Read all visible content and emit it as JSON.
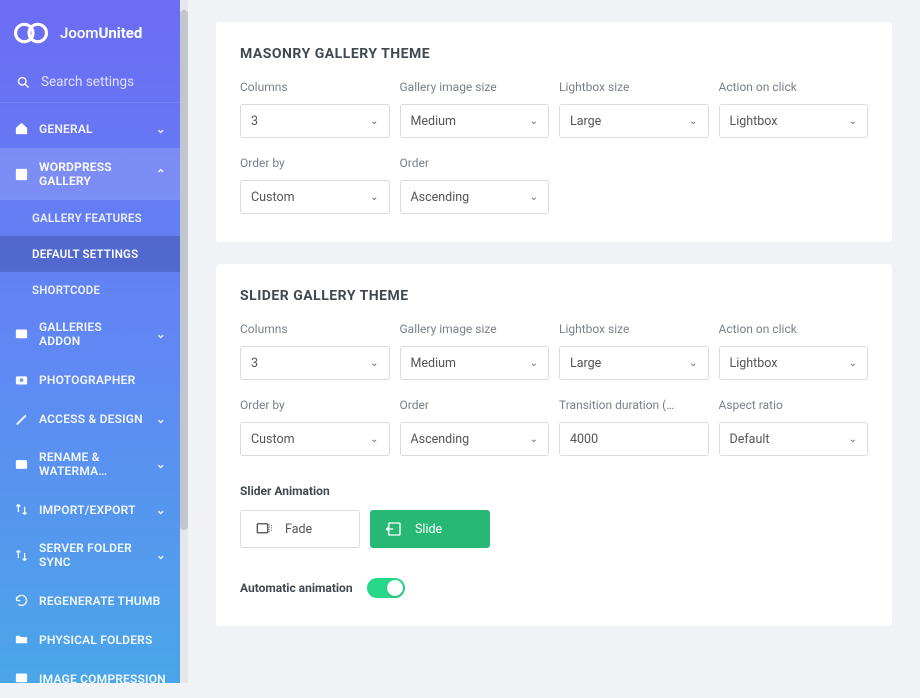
{
  "brand": {
    "part1": "Joom",
    "part2": "United"
  },
  "search": {
    "placeholder": "Search settings"
  },
  "nav": {
    "general": "GENERAL",
    "wordpress_gallery": "WORDPRESS GALLERY",
    "gallery_features": "GALLERY FEATURES",
    "default_settings": "DEFAULT SETTINGS",
    "shortcode": "SHORTCODE",
    "galleries_addon": "GALLERIES ADDON",
    "photographer": "PHOTOGRAPHER",
    "access_design": "ACCESS & DESIGN",
    "rename_watermark": "RENAME & WATERMA…",
    "import_export": "IMPORT/EXPORT",
    "server_folder_sync": "SERVER FOLDER SYNC",
    "regenerate_thumb": "REGENERATE THUMB",
    "physical_folders": "PHYSICAL FOLDERS",
    "image_compression": "IMAGE COMPRESSION"
  },
  "masonry": {
    "title": "MASONRY GALLERY THEME",
    "columns_label": "Columns",
    "columns_value": "3",
    "image_size_label": "Gallery image size",
    "image_size_value": "Medium",
    "lightbox_size_label": "Lightbox size",
    "lightbox_size_value": "Large",
    "action_label": "Action on click",
    "action_value": "Lightbox",
    "orderby_label": "Order by",
    "orderby_value": "Custom",
    "order_label": "Order",
    "order_value": "Ascending"
  },
  "slider": {
    "title": "SLIDER GALLERY THEME",
    "columns_label": "Columns",
    "columns_value": "3",
    "image_size_label": "Gallery image size",
    "image_size_value": "Medium",
    "lightbox_size_label": "Lightbox size",
    "lightbox_size_value": "Large",
    "action_label": "Action on click",
    "action_value": "Lightbox",
    "orderby_label": "Order by",
    "orderby_value": "Custom",
    "order_label": "Order",
    "order_value": "Ascending",
    "transition_label": "Transition duration (…",
    "transition_value": "4000",
    "aspect_label": "Aspect ratio",
    "aspect_value": "Default",
    "animation_label": "Slider Animation",
    "fade": "Fade",
    "slide": "Slide",
    "auto_label": "Automatic animation",
    "auto_on": true
  }
}
